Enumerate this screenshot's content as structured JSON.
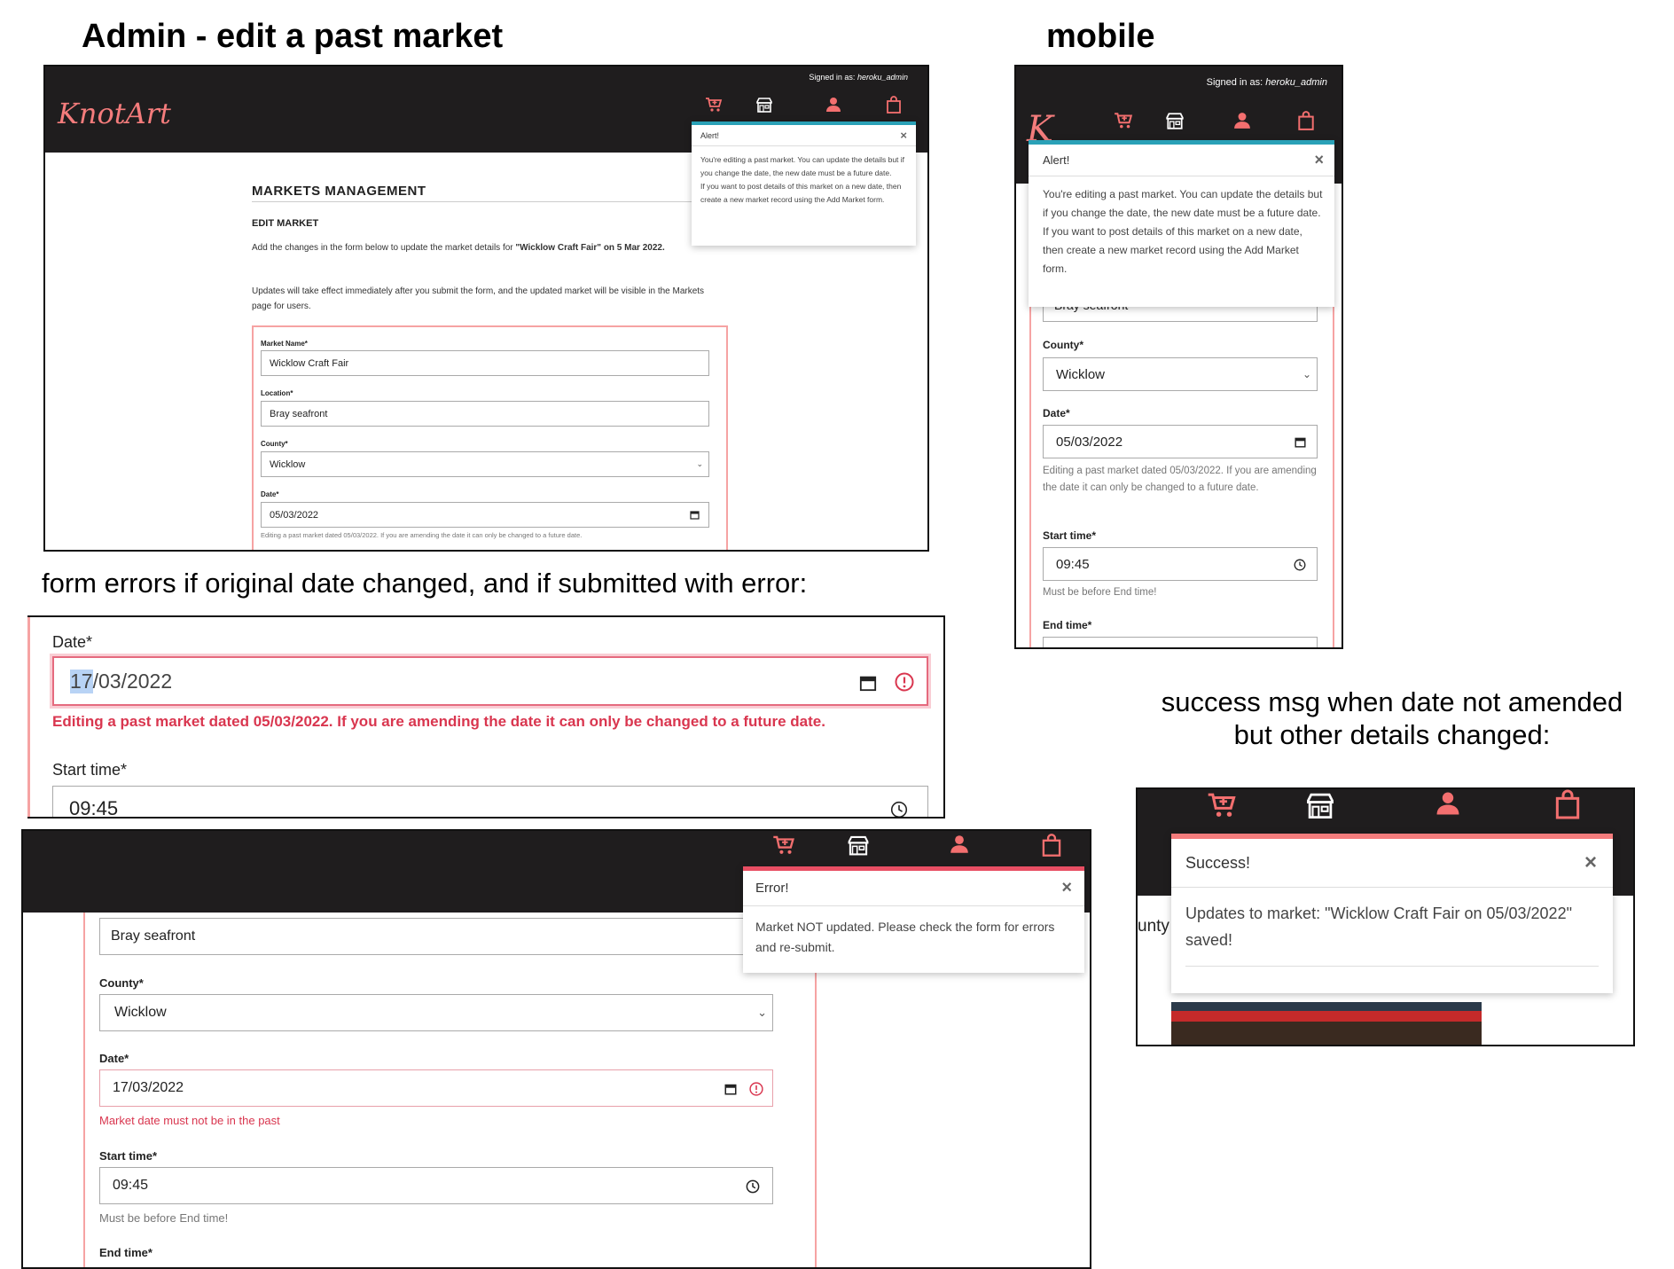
{
  "captions": {
    "admin_title": "Admin - edit a past market",
    "mobile_title": "mobile",
    "form_errors": "form errors if original date changed, and if submitted with error:",
    "success_line1": "success msg when date not amended",
    "success_line2": "but other details changed:"
  },
  "colors": {
    "nav_bg": "#1f1d1e",
    "accent": "#f36f6f",
    "error": "#d9364f",
    "info": "#2aa1b7"
  },
  "icons": [
    "cart-plus-icon",
    "store-icon",
    "user-icon",
    "bag-icon"
  ],
  "desktop": {
    "signed_in_label": "Signed in as:",
    "signed_in_user": "heroku_admin",
    "logo": "KnotArt",
    "alert": {
      "title": "Alert!",
      "close": "×",
      "body1": "You're editing a past market. You can update the details but if you change the date, the new date must be a future date.",
      "body2": "If you want to post details of this market on a new date, then create a new market record using the Add Market form."
    },
    "heading": "MARKETS MANAGEMENT",
    "subheading": "EDIT MARKET",
    "intro_pre": "Add the changes in the form below to update the market details for ",
    "intro_bold": "\"Wicklow Craft Fair\" on 5 Mar 2022.",
    "intro2": "Updates will take effect immediately after you submit the form, and the updated market will be visible in the Markets page for users.",
    "market_name_label": "Market Name*",
    "market_name_value": "Wicklow Craft Fair",
    "location_label": "Location*",
    "location_value": "Bray seafront",
    "county_label": "County*",
    "county_value": "Wicklow",
    "date_label": "Date*",
    "date_value": "05/03/2022",
    "date_help": "Editing a past market dated 05/03/2022. If you are amending the date it can only be changed to a future date."
  },
  "mobile": {
    "signed_in_label": "Signed in as:",
    "signed_in_user": "heroku_admin",
    "logo": "K",
    "alert": {
      "title": "Alert!",
      "close": "×",
      "body1": "You're editing a past market. You can update the details but if you change the date, the new date must be a future date.",
      "body2": "If you want to post details of this market on a new date, then create a new market record using the Add Market form."
    },
    "hidden_field_text": "Bray seafront",
    "county_label": "County*",
    "county_value": "Wicklow",
    "date_label": "Date*",
    "date_value": "05/03/2022",
    "date_help": "Editing a past market dated 05/03/2022. If you are amending the date it can only be changed to a future date.",
    "start_label": "Start time*",
    "start_value": "09:45",
    "start_help": "Must be before End time!",
    "end_label": "End time*"
  },
  "zoom": {
    "date_label": "Date*",
    "date_selected": "17",
    "date_rest": "/03/2022",
    "error_text": "Editing a past market dated 05/03/2022. If you are amending the date it can only be changed to a future date.",
    "start_label": "Start time*",
    "start_value": "09:45"
  },
  "error_shot": {
    "toast_title": "Error!",
    "close": "×",
    "toast_body": "Market NOT updated. Please check the form for errors and re-submit.",
    "location_value": "Bray seafront",
    "county_label": "County*",
    "county_value": "Wicklow",
    "date_label": "Date*",
    "date_value": "17/03/2022",
    "date_error": "Market date must not be in the past",
    "start_label": "Start time*",
    "start_value": "09:45",
    "start_help": "Must be before End time!",
    "end_label": "End time*"
  },
  "success_shot": {
    "title": "Success!",
    "close": "×",
    "body": "Updates to market: \"Wicklow Craft Fair on 05/03/2022\" saved!",
    "side_text": "unty"
  }
}
